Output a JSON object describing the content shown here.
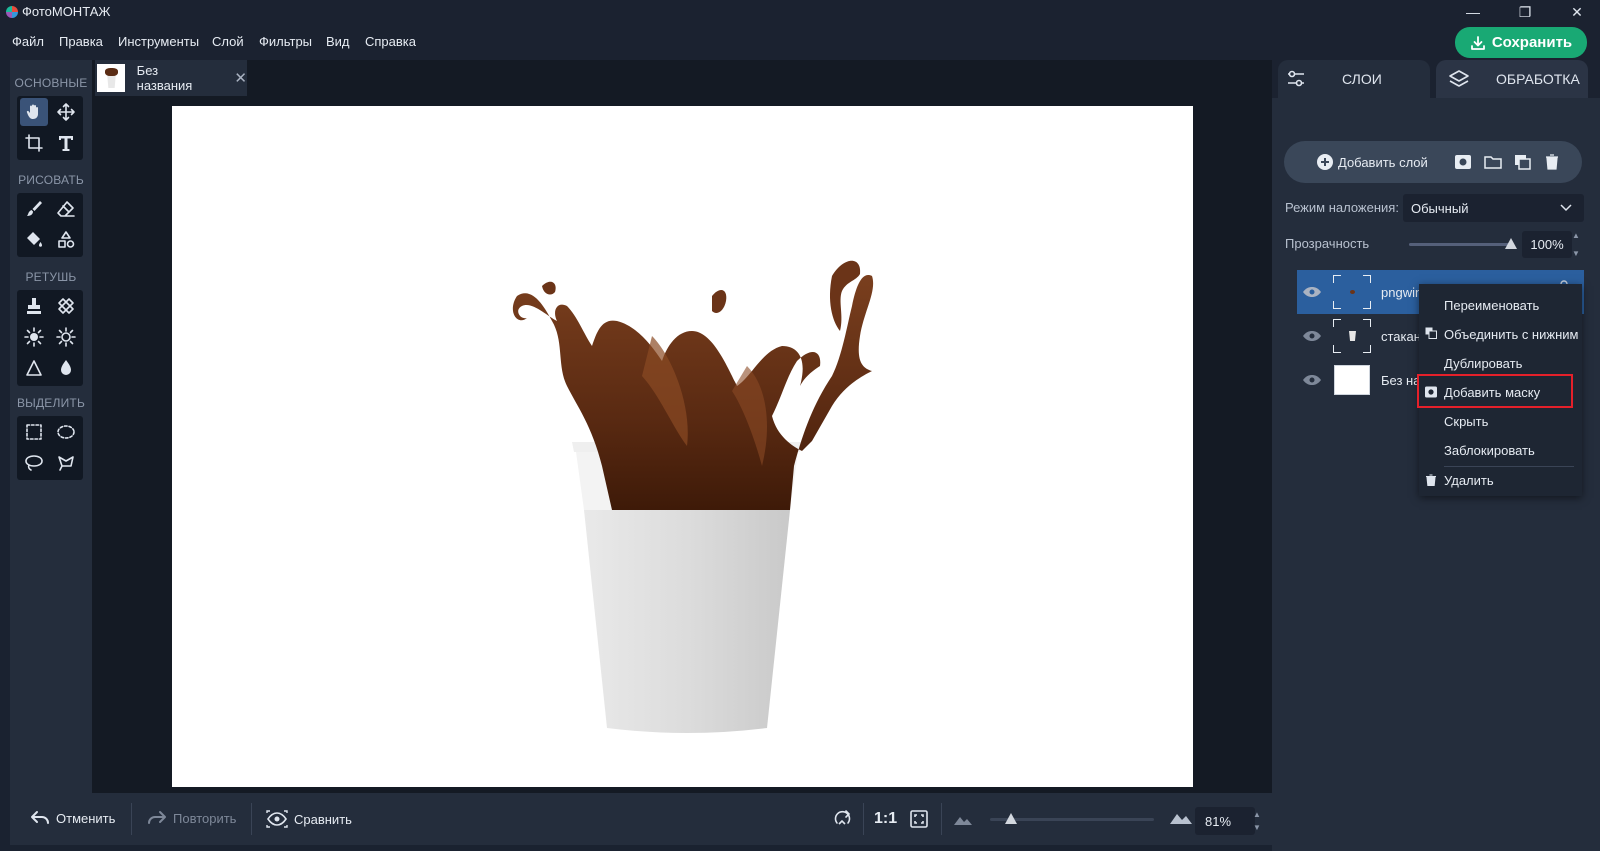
{
  "app": {
    "title": "ФотоМОНТАЖ"
  },
  "window_controls": {
    "minimize": "—",
    "maximize": "❐",
    "close": "✕"
  },
  "menu": [
    "Файл",
    "Правка",
    "Инструменты",
    "Слой",
    "Фильтры",
    "Вид",
    "Справка"
  ],
  "save_button": "Сохранить",
  "tools": {
    "sections": [
      "ОСНОВНЫЕ",
      "РИСОВАТЬ",
      "РЕТУШЬ",
      "ВЫДЕЛИТЬ"
    ]
  },
  "document": {
    "tab_label": "Без названия",
    "close": "✕"
  },
  "bottom": {
    "undo": "Отменить",
    "redo": "Повторить",
    "compare": "Сравнить",
    "actual_size": "1:1",
    "zoom": "81%",
    "zoom_fraction": 0.81
  },
  "right_panel": {
    "tab_layers": "СЛОИ",
    "tab_processing": "ОБРАБОТКА",
    "add_layer": "Добавить слой",
    "blend_label": "Режим наложения:",
    "blend_value": "Обычный",
    "opacity_label": "Прозрачность",
    "opacity_value": "100%",
    "layers": [
      {
        "name": "pngwing"
      },
      {
        "name": "стакан"
      },
      {
        "name": "Без наз"
      }
    ]
  },
  "context_menu": {
    "items": [
      "Переименовать",
      "Объединить с нижним",
      "Дублировать",
      "Добавить маску",
      "Скрыть",
      "Заблокировать",
      "Удалить"
    ],
    "highlighted": "Добавить маску"
  },
  "colors": {
    "accent_green": "#19a974",
    "selected_layer": "#2b5f9e",
    "highlight_border": "#e5202a"
  }
}
